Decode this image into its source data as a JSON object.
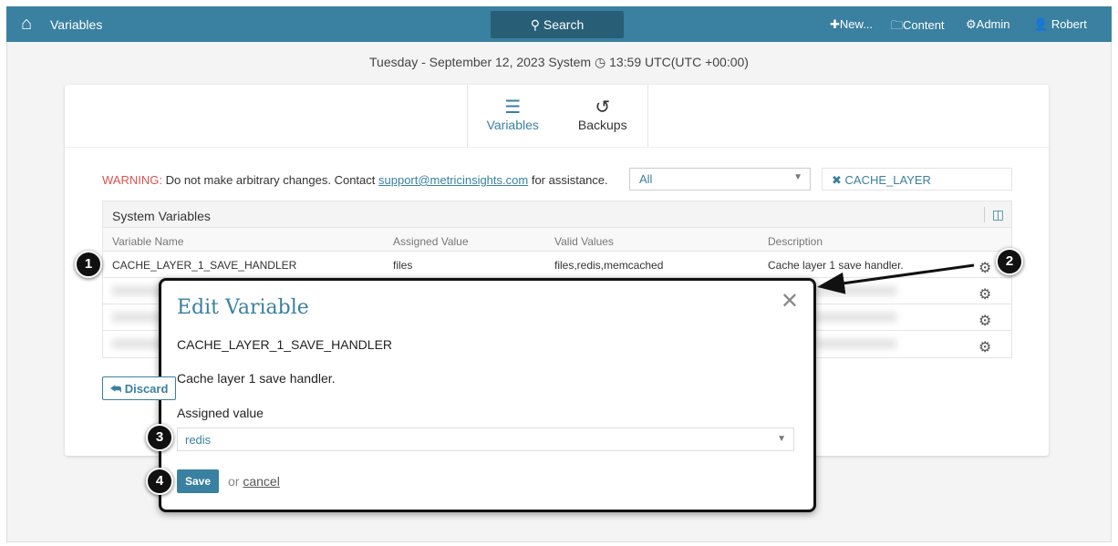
{
  "header": {
    "title": "Variables",
    "search": "Search",
    "new": "New...",
    "content": "Content",
    "admin": "Admin",
    "user": "Robert"
  },
  "date": "Tuesday - September 12, 2023 System",
  "time": "13:59 UTC(UTC +00:00)",
  "tabs": [
    {
      "label": "Variables"
    },
    {
      "label": "Backups"
    }
  ],
  "warning": {
    "label": "WARNING:",
    "text": "Do not make arbitrary changes. Contact",
    "email": "support@metricinsights.com",
    "suffix": "for assistance."
  },
  "filter": {
    "select": "All",
    "tag": "CACHE_LAYER"
  },
  "table": {
    "title": "System Variables",
    "columns": [
      "Variable Name",
      "Assigned Value",
      "Valid Values",
      "Description"
    ],
    "row": {
      "name": "CACHE_LAYER_1_SAVE_HANDLER",
      "value": "files",
      "valid": "files,redis,memcached",
      "description": "Cache layer 1 save handler."
    }
  },
  "discard": "Discard",
  "modal": {
    "title": "Edit Variable",
    "name": "CACHE_LAYER_1_SAVE_HANDLER",
    "description": "Cache layer 1 save handler.",
    "label": "Assigned value",
    "value": "redis",
    "save": "Save",
    "or": "or",
    "cancel": "cancel"
  },
  "badges": [
    "1",
    "2",
    "3",
    "4"
  ]
}
